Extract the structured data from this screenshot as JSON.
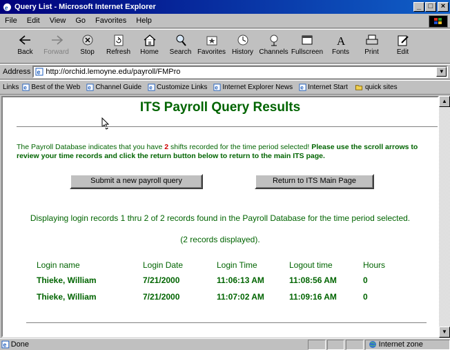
{
  "window": {
    "title": "Query List - Microsoft Internet Explorer",
    "controls": [
      "_",
      "□",
      "×"
    ]
  },
  "menu": [
    "File",
    "Edit",
    "View",
    "Go",
    "Favorites",
    "Help"
  ],
  "toolbar": [
    {
      "label": "Back",
      "icon": "back-arrow-icon",
      "enabled": true
    },
    {
      "label": "Forward",
      "icon": "forward-arrow-icon",
      "enabled": false
    },
    {
      "label": "Stop",
      "icon": "stop-icon",
      "enabled": true
    },
    {
      "label": "Refresh",
      "icon": "refresh-icon",
      "enabled": true
    },
    {
      "label": "Home",
      "icon": "home-icon",
      "enabled": true
    },
    {
      "label": "Search",
      "icon": "search-icon",
      "enabled": true
    },
    {
      "label": "Favorites",
      "icon": "favorites-icon",
      "enabled": true
    },
    {
      "label": "History",
      "icon": "history-icon",
      "enabled": true
    },
    {
      "label": "Channels",
      "icon": "channels-icon",
      "enabled": true
    },
    {
      "label": "Fullscreen",
      "icon": "fullscreen-icon",
      "enabled": true
    },
    {
      "label": "Fonts",
      "icon": "fonts-icon",
      "enabled": true
    },
    {
      "label": "Print",
      "icon": "print-icon",
      "enabled": true
    },
    {
      "label": "Edit",
      "icon": "edit-icon",
      "enabled": true
    }
  ],
  "address": {
    "label": "Address",
    "url": "http://orchid.lemoyne.edu/payroll/FMPro"
  },
  "links": {
    "label": "Links",
    "items": [
      "Best of the Web",
      "Channel Guide",
      "Customize Links",
      "Internet Explorer News",
      "Internet Start",
      "quick sites"
    ]
  },
  "page": {
    "title": "ITS Payroll Query Results",
    "message_pre": "The Payroll Database indicates that you have ",
    "shift_count": "2",
    "message_mid": " shifts recorded for the time period selected! ",
    "message_bold": "Please use the scroll arrows to review your time records and click the return button below to return to the main ITS page.",
    "btn_query": "Submit a new payroll query",
    "btn_return": "Return to ITS Main Page",
    "display_line": "Displaying login records 1 thru 2 of 2 records found in the Payroll Database for the time period selected.",
    "display_count": "(2 records displayed).",
    "columns": [
      "Login name",
      "Login Date",
      "Login Time",
      "Logout time",
      "Hours"
    ],
    "rows": [
      [
        "Thieke, William",
        "7/21/2000",
        "11:06:13 AM",
        "11:08:56 AM",
        "0"
      ],
      [
        "Thieke, William",
        "7/21/2000",
        "11:07:02 AM",
        "11:09:16 AM",
        "0"
      ]
    ]
  },
  "status": {
    "text": "Done",
    "zone": "Internet zone"
  },
  "colors": {
    "page_green": "#006400",
    "count_red": "#d00000",
    "titlebar": "#00007b"
  }
}
